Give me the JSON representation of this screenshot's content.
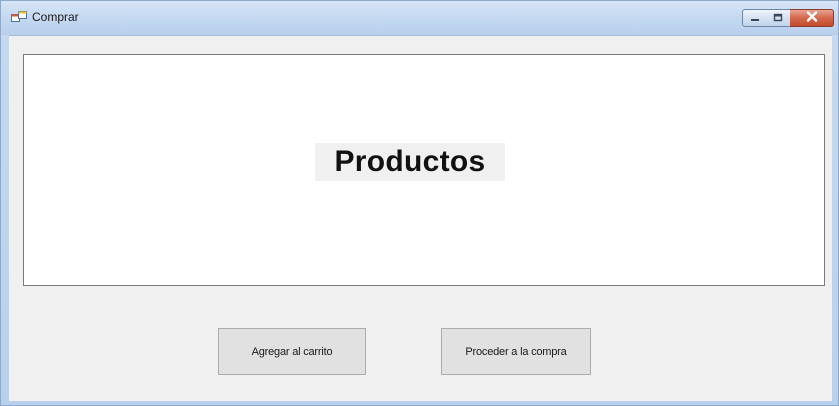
{
  "window": {
    "title": "Comprar",
    "app_icon": "form-icon",
    "controls": {
      "minimize_icon": "minimize-icon",
      "maximize_icon": "maximize-icon",
      "close_icon": "close-icon"
    }
  },
  "panel": {
    "heading": "Productos"
  },
  "actions": {
    "add_to_cart_label": "Agregar al carrito",
    "checkout_label": "Proceder a la compra"
  },
  "colors": {
    "client_background": "#f0f0f0",
    "panel_background": "#ffffff",
    "button_background": "#e1e1e1",
    "close_button": "#c44a2e"
  }
}
